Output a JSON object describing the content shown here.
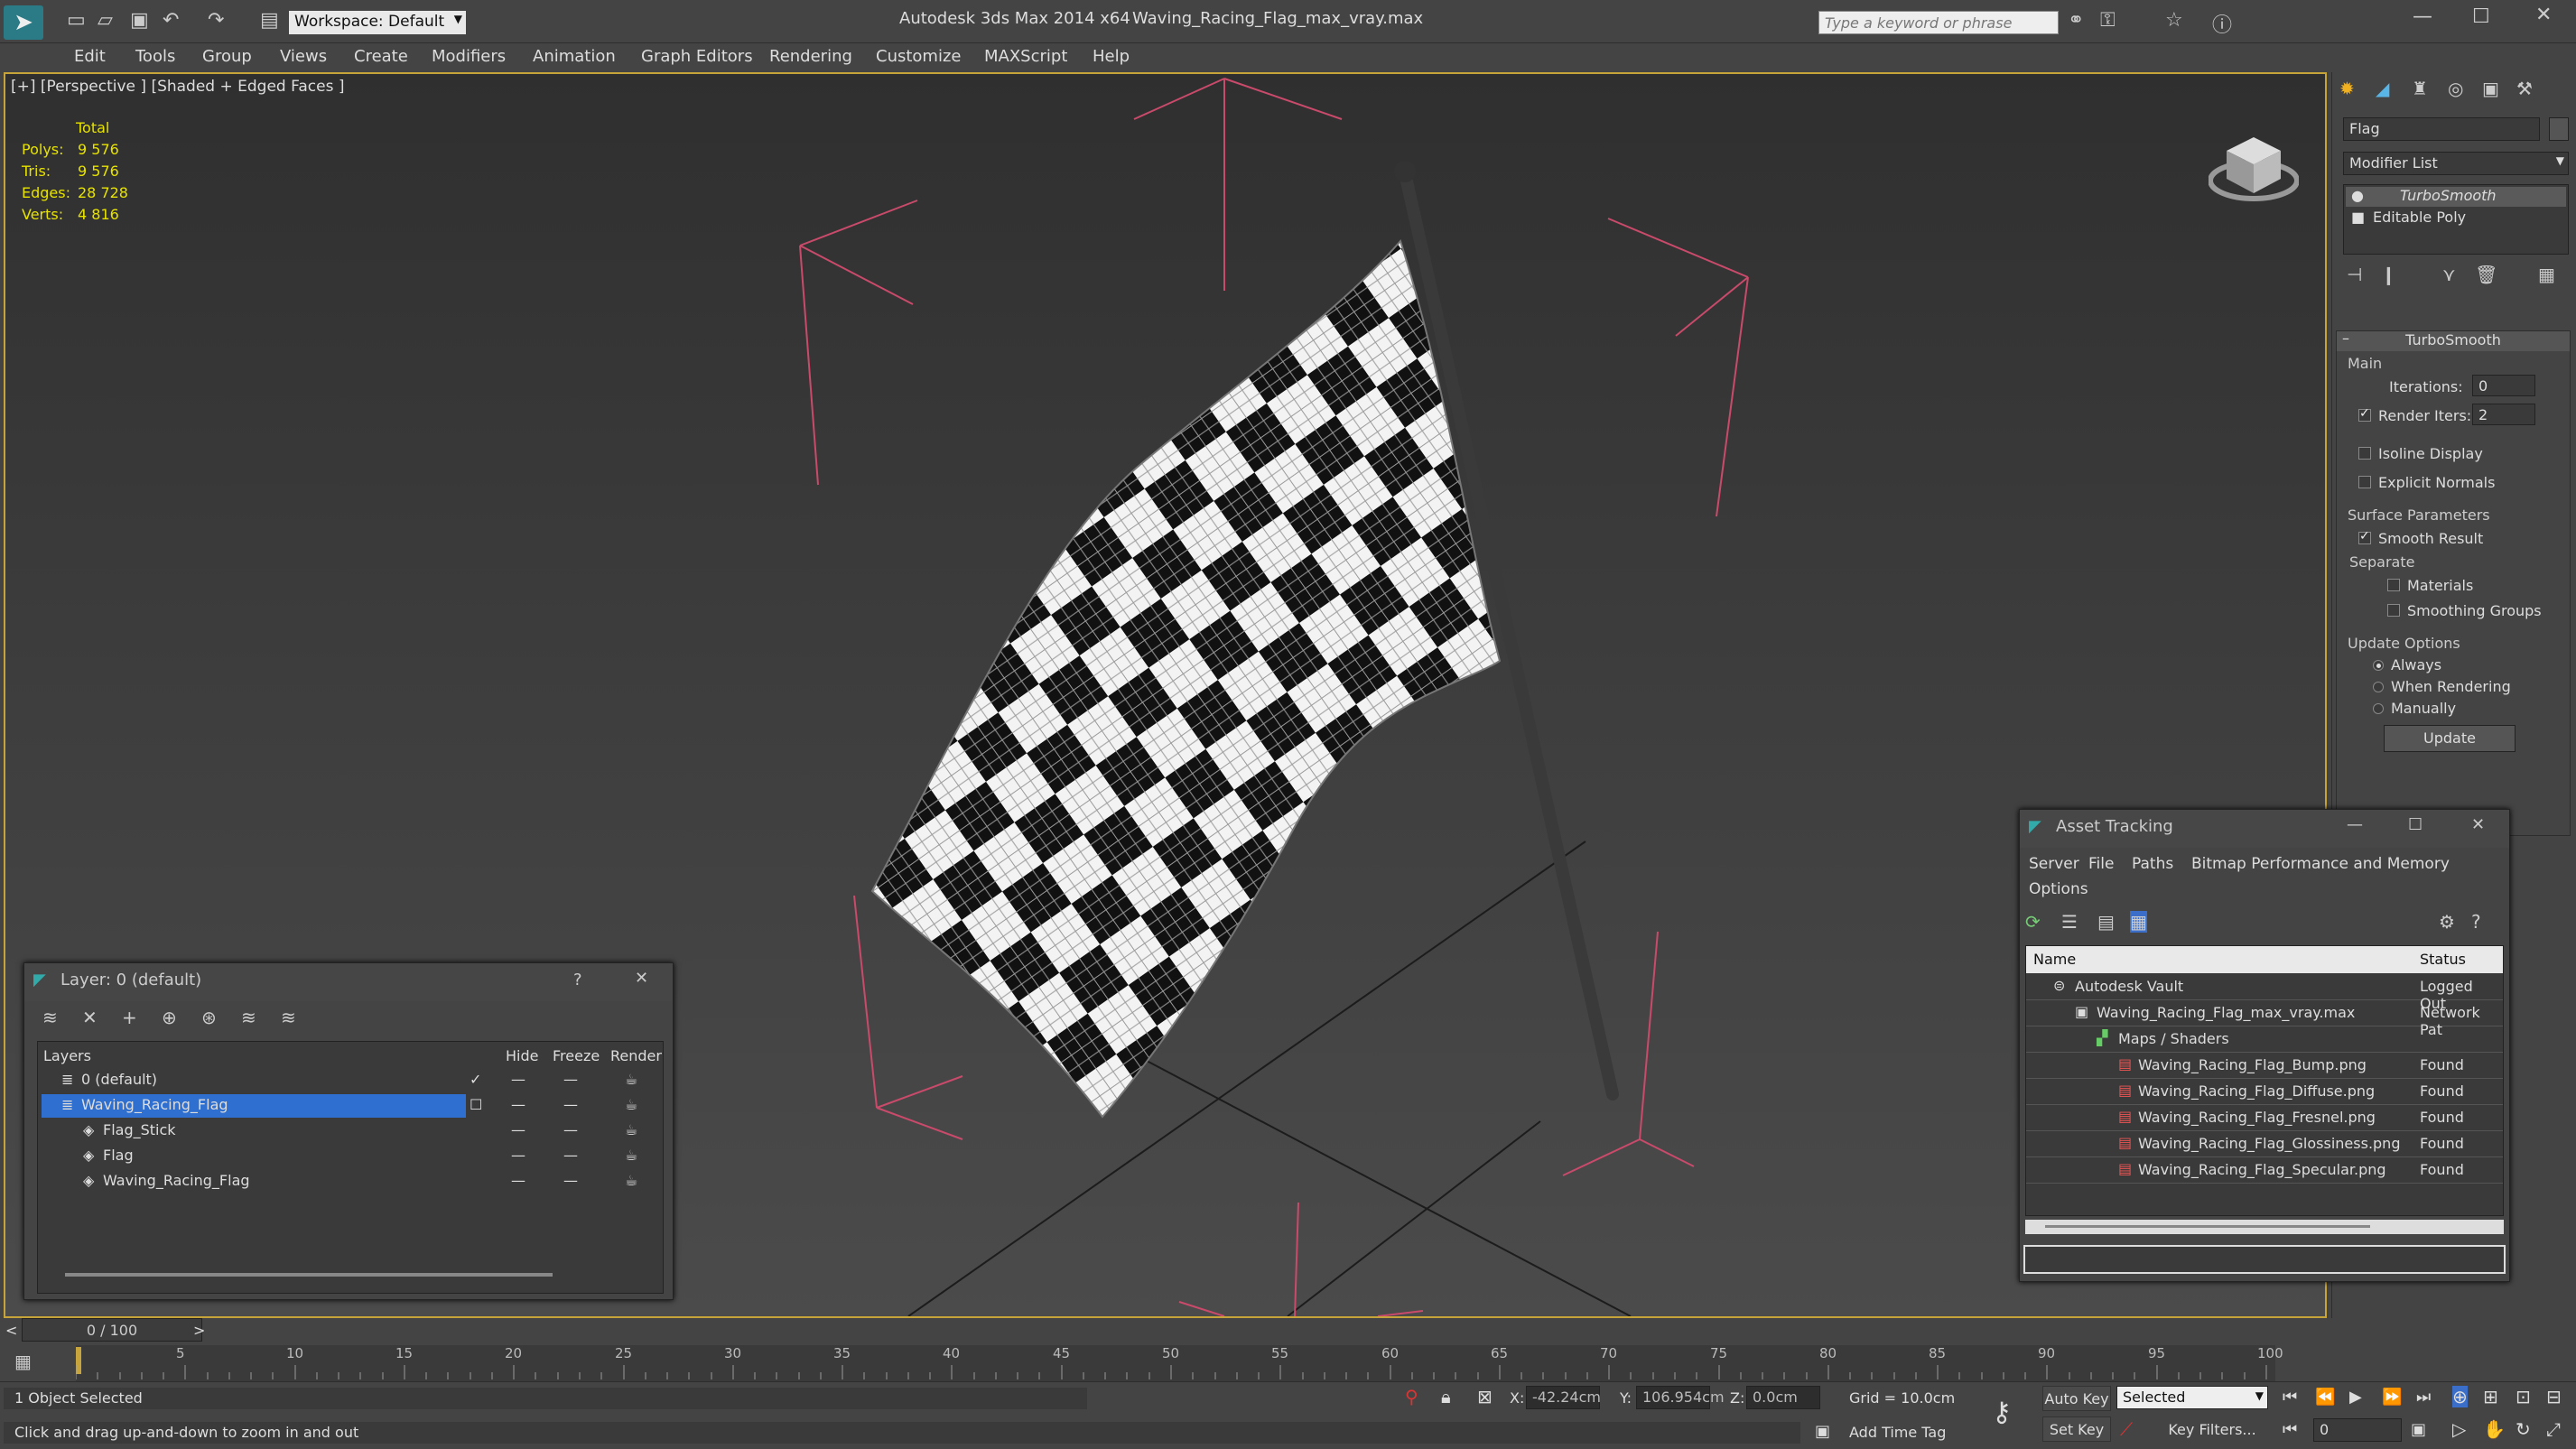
{
  "titlebar": {
    "app_title": "Autodesk 3ds Max  2014 x64",
    "file_title": "Waving_Racing_Flag_max_vray.max",
    "workspace_label": "Workspace: Default",
    "search_placeholder": "Type a keyword or phrase"
  },
  "menu": [
    "Edit",
    "Tools",
    "Group",
    "Views",
    "Create",
    "Modifiers",
    "Animation",
    "Graph Editors",
    "Rendering",
    "Customize",
    "MAXScript",
    "Help"
  ],
  "viewport": {
    "label": "[+] [Perspective ] [Shaded + Edged Faces ]",
    "stats": {
      "header": "Total",
      "rows": [
        {
          "label": "Polys:",
          "value": "9 576"
        },
        {
          "label": "Tris:",
          "value": "9 576"
        },
        {
          "label": "Edges:",
          "value": "28 728"
        },
        {
          "label": "Verts:",
          "value": "4 816"
        }
      ]
    }
  },
  "command_panel": {
    "object_name": "Flag",
    "modifier_list": "Modifier List",
    "stack": [
      "TurboSmooth",
      "Editable Poly"
    ],
    "rollout_title": "TurboSmooth",
    "main_label": "Main",
    "iterations_label": "Iterations:",
    "iterations_value": "0",
    "render_iters_label": "Render Iters:",
    "render_iters_value": "2",
    "isoline": "Isoline Display",
    "explicit": "Explicit Normals",
    "surface_params": "Surface Parameters",
    "smooth_result": "Smooth Result",
    "separate": "Separate",
    "materials": "Materials",
    "smoothing_groups": "Smoothing Groups",
    "update_options": "Update Options",
    "always": "Always",
    "when_rendering": "When Rendering",
    "manually": "Manually",
    "update_button": "Update"
  },
  "layer_window": {
    "title": "Layer: 0 (default)",
    "help": "?",
    "columns": [
      "Layers",
      "Hide",
      "Freeze",
      "Render"
    ],
    "rows": [
      {
        "name": "0 (default)"
      },
      {
        "name": "Waving_Racing_Flag"
      },
      {
        "name": "Flag_Stick"
      },
      {
        "name": "Flag"
      },
      {
        "name": "Waving_Racing_Flag"
      }
    ]
  },
  "asset_window": {
    "title": "Asset Tracking",
    "menu": [
      "Server",
      "File",
      "Paths",
      "Bitmap Performance and Memory",
      "Options"
    ],
    "columns": [
      "Name",
      "Status"
    ],
    "rows": [
      {
        "name": "Autodesk Vault",
        "status": "Logged Out"
      },
      {
        "name": "Waving_Racing_Flag_max_vray.max",
        "status": "Network Pat"
      },
      {
        "name": "Maps / Shaders",
        "status": ""
      },
      {
        "name": "Waving_Racing_Flag_Bump.png",
        "status": "Found"
      },
      {
        "name": "Waving_Racing_Flag_Diffuse.png",
        "status": "Found"
      },
      {
        "name": "Waving_Racing_Flag_Fresnel.png",
        "status": "Found"
      },
      {
        "name": "Waving_Racing_Flag_Glossiness.png",
        "status": "Found"
      },
      {
        "name": "Waving_Racing_Flag_Specular.png",
        "status": "Found"
      }
    ]
  },
  "timeline": {
    "frame_counter": "0 / 100",
    "ticks": [
      "5",
      "10",
      "15",
      "20",
      "25",
      "30",
      "35",
      "40",
      "45",
      "50",
      "55",
      "60",
      "65",
      "70",
      "75",
      "80",
      "85",
      "90",
      "95",
      "100"
    ]
  },
  "status": {
    "selected": "1 Object Selected",
    "hint": "Click and drag up-and-down to zoom in and out",
    "x_label": "X:",
    "x_value": "-42.24cm",
    "y_label": "Y:",
    "y_value": "106.954cm",
    "z_label": "Z:",
    "z_value": "0.0cm",
    "grid": "Grid = 10.0cm",
    "add_time_tag": "Add Time Tag",
    "auto_key": "Auto Key",
    "set_key": "Set Key",
    "selected_dropdown": "Selected",
    "key_filters": "Key Filters...",
    "frame_value": "0"
  }
}
